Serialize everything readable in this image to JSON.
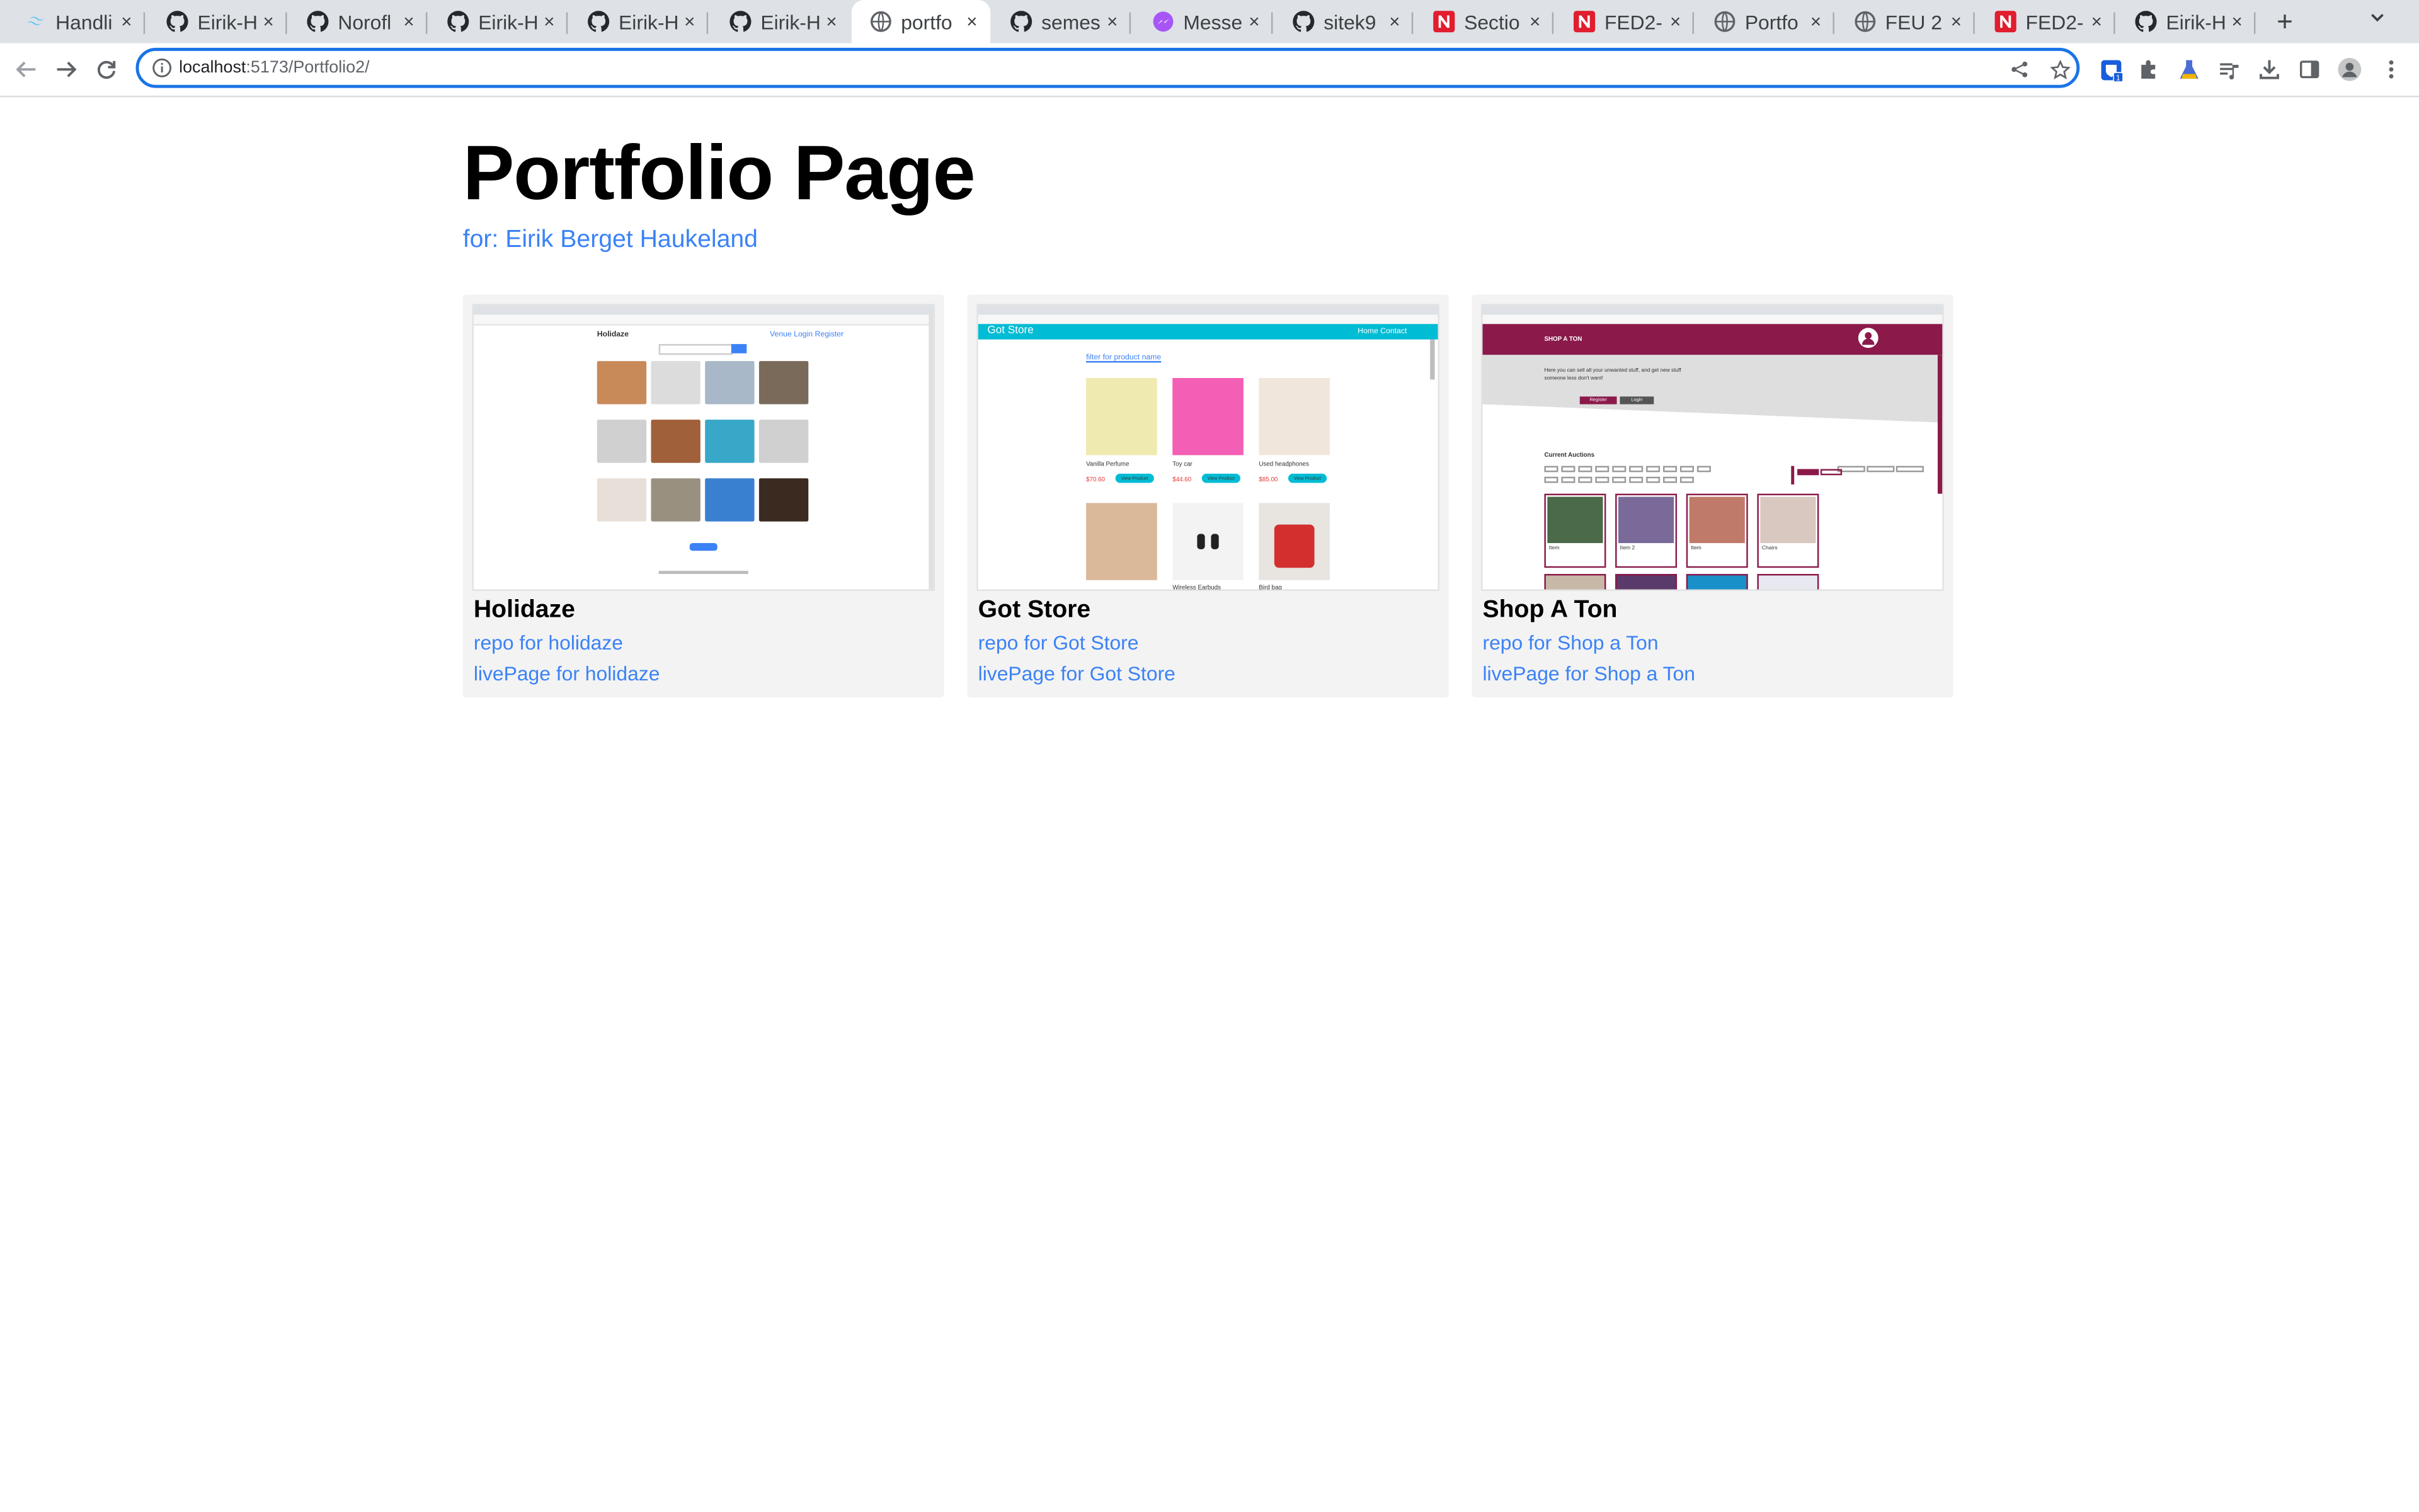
{
  "browser": {
    "tabs": [
      {
        "title": "Handli",
        "icon": "tailwind-icon"
      },
      {
        "title": "Eirik-H",
        "icon": "github-icon"
      },
      {
        "title": "Norofl",
        "icon": "github-icon"
      },
      {
        "title": "Eirik-H",
        "icon": "github-icon"
      },
      {
        "title": "Eirik-H",
        "icon": "github-icon"
      },
      {
        "title": "Eirik-H",
        "icon": "github-icon"
      },
      {
        "title": "portfo",
        "icon": "globe-icon",
        "active": true
      },
      {
        "title": "semes",
        "icon": "github-icon"
      },
      {
        "title": "Messe",
        "icon": "messenger-icon"
      },
      {
        "title": "sitek9",
        "icon": "github-icon"
      },
      {
        "title": "Sectio",
        "icon": "noroff-icon"
      },
      {
        "title": "FED2-",
        "icon": "noroff-icon"
      },
      {
        "title": "Portfo",
        "icon": "globe-icon"
      },
      {
        "title": "FEU 2",
        "icon": "globe-icon"
      },
      {
        "title": "FED2-",
        "icon": "noroff-icon"
      },
      {
        "title": "Eirik-H",
        "icon": "github-icon"
      }
    ],
    "close_glyph": "×",
    "new_tab_glyph": "+",
    "address": {
      "host": "localhost",
      "path": ":5173/Portfolio2/"
    }
  },
  "page": {
    "title": "Portfolio Page",
    "subtitle": "for: Eirik Berget Haukeland",
    "link_color": "#3b82f6",
    "cards": [
      {
        "title": "Holidaze",
        "repo_link": "repo for holidaze",
        "live_link": "livePage for holidaze",
        "screenshot": {
          "brand": "Holidaze",
          "nav": "Venue   Login   Register"
        }
      },
      {
        "title": "Got Store",
        "repo_link": "repo for Got Store",
        "live_link": "livePage for Got Store",
        "screenshot": {
          "brand": "Got Store",
          "nav": "Home   Contact",
          "search": "filter for product name",
          "products": [
            "Vanilla Perfume",
            "Toy car",
            "Used headphones",
            "Wireless Earbuds",
            "Bird bag"
          ],
          "prices": [
            "$70.60",
            "$44.60",
            "$85.00"
          ],
          "button": "View Product",
          "accent": "#00bcd4"
        }
      },
      {
        "title": "Shop A Ton",
        "repo_link": "repo for Shop a Ton",
        "live_link": "livePage for Shop a Ton",
        "screenshot": {
          "brand": "SHOP A TON",
          "tagline": "Here you can sell all your unwanted stuff, and get new stuff someone less don't want!",
          "register": "Register",
          "login": "Login",
          "section": "Current Auctions",
          "items": [
            "Item",
            "Item 2",
            "Item",
            "Chairs"
          ],
          "accent": "#8b1a4a"
        }
      }
    ]
  }
}
